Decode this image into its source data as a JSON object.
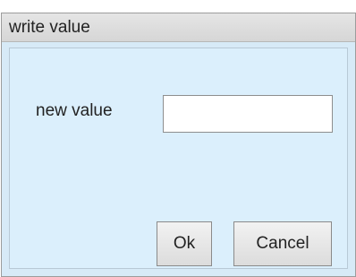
{
  "dialog": {
    "title": "write value",
    "field_label": "new value",
    "input_value": "",
    "ok_label": "Ok",
    "cancel_label": "Cancel"
  }
}
